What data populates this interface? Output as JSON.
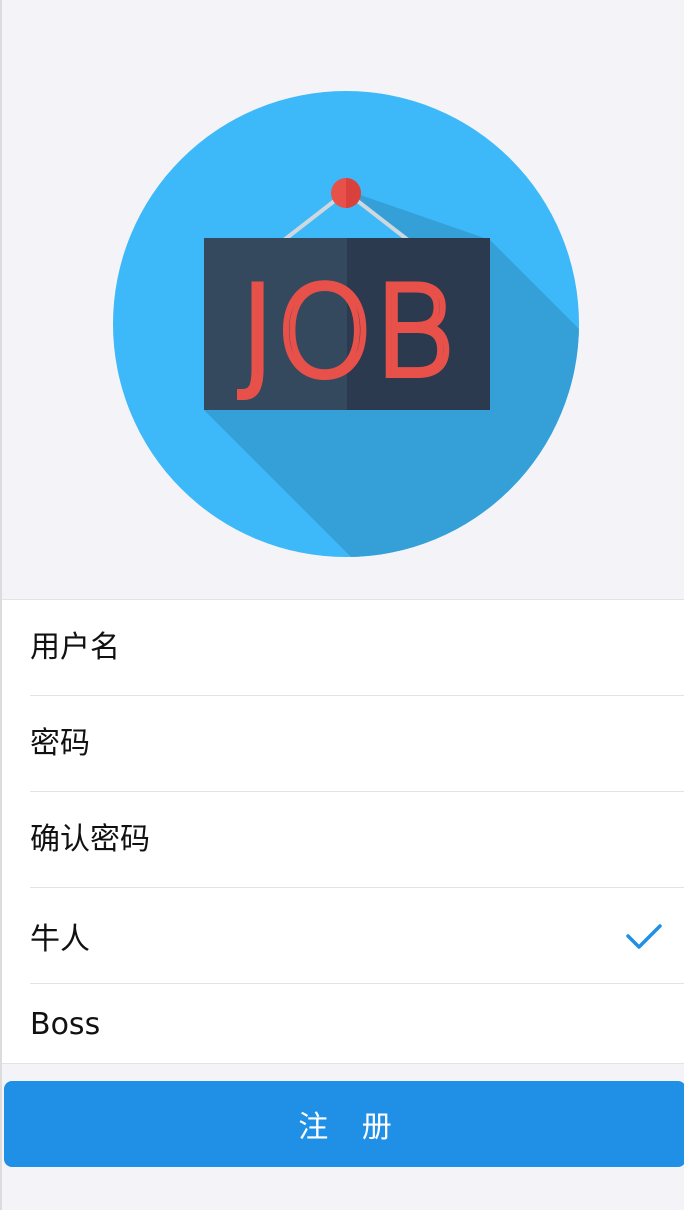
{
  "form": {
    "username_placeholder": "用户名",
    "password_placeholder": "密码",
    "confirm_placeholder": "确认密码",
    "role_options": [
      "牛人",
      "Boss"
    ],
    "selected_role": "牛人"
  },
  "submit_label": "注 册",
  "logo": {
    "text": "JOB",
    "icon": "job-sign-icon"
  },
  "colors": {
    "accent": "#2090e6",
    "logo_circle": "#3db9fa",
    "logo_shadow": "#359fd7",
    "sign_board": "#2c3e50",
    "sign_text": "#e8514a",
    "pin": "#e8514a"
  }
}
